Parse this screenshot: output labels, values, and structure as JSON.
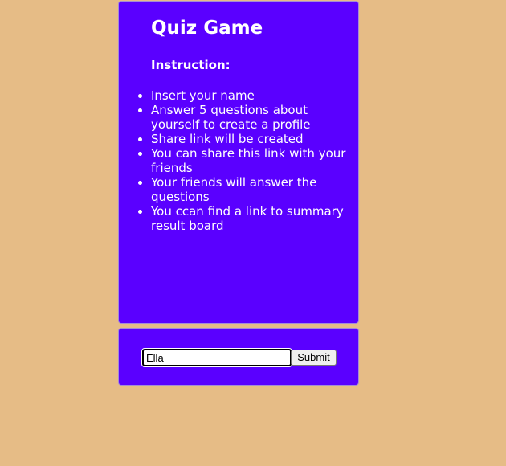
{
  "app": {
    "title": "Quiz Game"
  },
  "instructions": {
    "heading": "Instruction:",
    "items": [
      "Insert your name",
      "Answer 5 questions about yourself to create a profile",
      "Share link will be created",
      "You can share this link with your friends",
      "Your friends will answer the questions",
      "You ccan find a link to summary result board"
    ]
  },
  "form": {
    "name_value": "Ella",
    "submit_label": "Submit"
  },
  "colors": {
    "background": "#e6bc86",
    "card": "#5a00ff",
    "text": "#ffffff"
  }
}
